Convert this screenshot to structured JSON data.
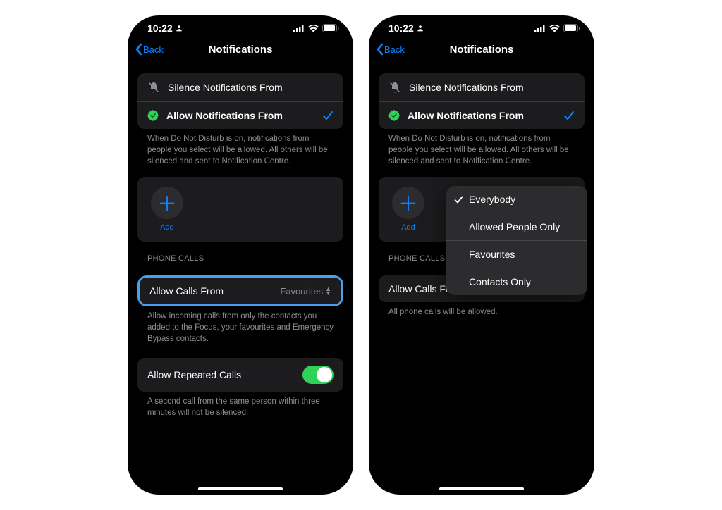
{
  "status": {
    "time": "10:22"
  },
  "nav": {
    "back": "Back",
    "title": "Notifications"
  },
  "mode_group": {
    "silence": "Silence Notifications From",
    "allow": "Allow Notifications From",
    "footer": "When Do Not Disturb is on, notifications from people you select will be allowed. All others will be silenced and sent to Notification Centre."
  },
  "add": {
    "label": "Add"
  },
  "phone_calls": {
    "header": "PHONE CALLS",
    "allow_from_label": "Allow Calls From"
  },
  "left_screen": {
    "allow_from_value": "Favourites",
    "calls_footer": "Allow incoming calls from only the contacts you added to the Focus, your favourites and Emergency Bypass contacts.",
    "repeated_label": "Allow Repeated Calls",
    "repeated_footer": "A second call from the same person within three minutes will not be silenced."
  },
  "right_screen": {
    "allow_from_value": "Everybody",
    "calls_footer": "All phone calls will be allowed.",
    "popover_options": {
      "o0": "Everybody",
      "o1": "Allowed People Only",
      "o2": "Favourites",
      "o3": "Contacts Only"
    }
  }
}
